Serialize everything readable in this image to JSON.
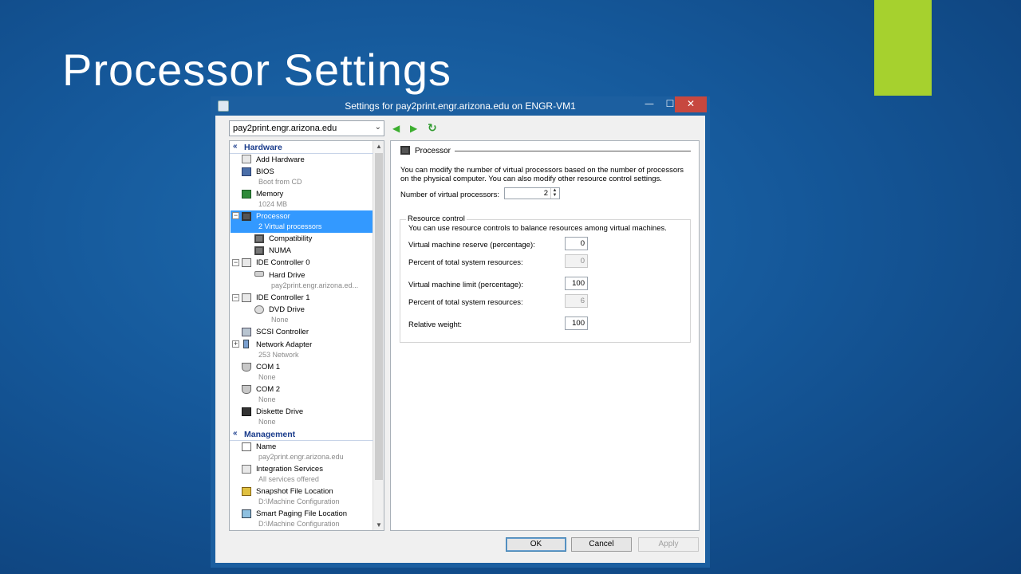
{
  "slide": {
    "title": "Processor Settings"
  },
  "window": {
    "title": "Settings for pay2print.engr.arizona.edu on ENGR-VM1",
    "minimize": "—",
    "maximize": "☐",
    "close": "✕"
  },
  "vm_selector": {
    "value": "pay2print.engr.arizona.edu"
  },
  "toolbar": {
    "back": "◀",
    "forward": "▶",
    "refresh": "↻"
  },
  "tree": {
    "hardware_header": "Hardware",
    "management_header": "Management",
    "items": {
      "add_hardware": "Add Hardware",
      "bios": "BIOS",
      "bios_sub": "Boot from CD",
      "memory": "Memory",
      "memory_sub": "1024 MB",
      "processor": "Processor",
      "processor_sub": "2 Virtual processors",
      "compatibility": "Compatibility",
      "numa": "NUMA",
      "ide0": "IDE Controller 0",
      "hard_drive": "Hard Drive",
      "hard_drive_sub": "pay2print.engr.arizona.ed...",
      "ide1": "IDE Controller 1",
      "dvd": "DVD Drive",
      "dvd_sub": "None",
      "scsi": "SCSI Controller",
      "network": "Network Adapter",
      "network_sub": "253 Network",
      "com1": "COM 1",
      "com1_sub": "None",
      "com2": "COM 2",
      "com2_sub": "None",
      "diskette": "Diskette Drive",
      "diskette_sub": "None",
      "name": "Name",
      "name_sub": "pay2print.engr.arizona.edu",
      "integration": "Integration Services",
      "integration_sub": "All services offered",
      "snapshot": "Snapshot File Location",
      "snapshot_sub": "D:\\Machine Configuration",
      "paging": "Smart Paging File Location",
      "paging_sub": "D:\\Machine Configuration"
    }
  },
  "panel": {
    "header": "Processor",
    "description": "You can modify the number of virtual processors based on the number of processors on the physical computer. You can also modify other resource control settings.",
    "num_vp_label": "Number of virtual processors:",
    "num_vp_value": "2",
    "resource_control_title": "Resource control",
    "resource_control_desc": "You can use resource controls to balance resources among virtual machines.",
    "reserve_label": "Virtual machine reserve (percentage):",
    "reserve_value": "0",
    "pct_total_label_1": "Percent of total system resources:",
    "pct_total_value_1": "0",
    "limit_label": "Virtual machine limit (percentage):",
    "limit_value": "100",
    "pct_total_label_2": "Percent of total system resources:",
    "pct_total_value_2": "6",
    "weight_label": "Relative weight:",
    "weight_value": "100"
  },
  "buttons": {
    "ok": "OK",
    "cancel": "Cancel",
    "apply": "Apply"
  }
}
